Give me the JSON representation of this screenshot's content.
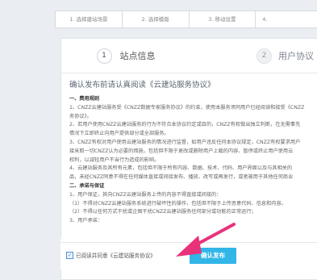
{
  "step_bar": {
    "steps": [
      "1. 选择建站场景",
      "2. 选择模版",
      "3. 移动设置",
      "4."
    ]
  },
  "tabs": [
    {
      "number": "1",
      "label": "站点信息"
    },
    {
      "number": "2",
      "label": "用户协议"
    }
  ],
  "agreement": {
    "heading": "确认发布前请认真阅读《云建站服务协议》",
    "lines": [
      "一、费用规则",
      "1、CNZZ云建站服务受《CNZZ数据专家服务协议》的约束，使用本服务须同用户已经阅读和接受《CNZZ",
      "务协议》。",
      "2、若用户使用CNZZ云建站服务的行为不符合本协议约定或目的，CNZZ有权做出独立判断，在无需事先",
      "情况下立即终止向用户提供部分或全部服务。",
      "3、CNZZ有权对用户使用云建站服务的情况进行监督，如用户违反任何本协议规定，CNZZ有权要求用户",
      "接采取一切CNZZ认为必要的措施，包括但不限于更改或删除用户上载的内容、暂停或终止用户使用云",
      "权利，以减轻用户不当行为造成的影响。",
      "4、云建站服务及其所有元素，包括但不限于所有内容、数据、技术、代码、用户界面以及与其相关的",
      "品，未经CNZZ同意不得在任何媒体直接或间接发布、播放、改写或再发行，或者被用于其他任何商业",
      "二、承诺与保证",
      "1、用户保证，其向CNZZ云建站服务上传的内容不得直接或间接的：",
      "（1）不得对CNZZ云建站服务系统进行破坏性的操作，包括但不限于上传恶意代码、信息和内容。",
      "（2）不得以任何方式干扰或企图干扰CNZZ云建站服务任何部分或功能的正常运行；",
      "3、用户承诺："
    ]
  },
  "footer": {
    "checkbox_checked": true,
    "checkbox_mark": "✓",
    "agree_label": "已阅读并同意《云建站服务协议》",
    "publish_label": "确认发布"
  },
  "colors": {
    "publish_button": "#32b6e8",
    "link": "#3a7bc8",
    "arrow": "#e8337a"
  }
}
